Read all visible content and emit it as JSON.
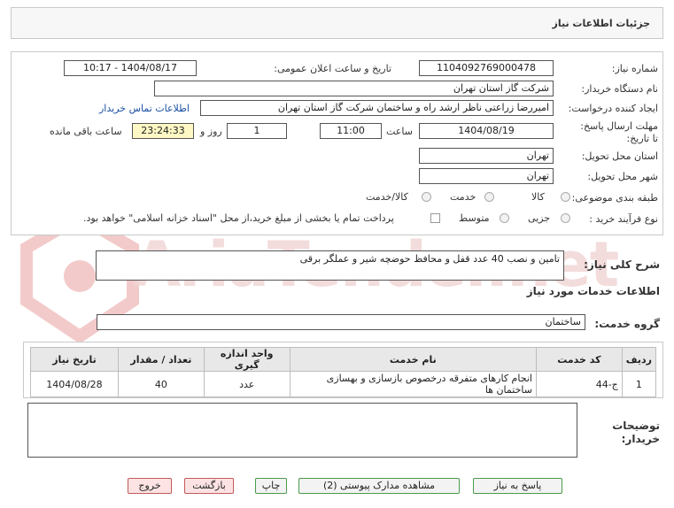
{
  "header": {
    "title": "جزئیات اطلاعات نیاز"
  },
  "form": {
    "need_number_label": "شماره نیاز:",
    "need_number": "1104092769000478",
    "announce_label": "تاریخ و ساعت اعلان عمومی:",
    "announce_value": "1404/08/17 - 10:17",
    "buyer_org_label": "نام دستگاه خریدار:",
    "buyer_org": "شرکت گاز استان تهران",
    "creator_label": "ایجاد کننده درخواست:",
    "creator": "امیررضا زراعتی ناظر ارشد راه و ساختمان شرکت گاز استان تهران",
    "contact_link": "اطلاعات تماس خریدار",
    "deadline_label": "مهلت ارسال پاسخ: تا تاریخ:",
    "deadline_date": "1404/08/19",
    "time_label": "ساعت",
    "deadline_time": "11:00",
    "days": "1",
    "days_label": "روز و",
    "remaining": "23:24:33",
    "remaining_label": "ساعت باقی مانده",
    "province_label": "استان محل تحویل:",
    "province": "تهران",
    "city_label": "شهر محل تحویل:",
    "city": "تهران",
    "category_label": "طبقه بندی موضوعی:",
    "category_options": [
      "کالا",
      "خدمت",
      "کالا/خدمت"
    ],
    "process_label": "نوع فرآیند خرید :",
    "process_options": [
      "جزیی",
      "متوسط"
    ],
    "payment_note": "پرداخت تمام یا بخشی از مبلغ خرید،از محل \"اسناد خزانه اسلامی\" خواهد بود."
  },
  "description": {
    "label": "شرح کلی نیاز:",
    "value": "تامین و نصب 40 عدد قفل و محافظ حوضچه شیر و عملگر برقی"
  },
  "services": {
    "section_title": "اطلاعات خدمات مورد نیاز",
    "group_label": "گروه خدمت:",
    "group_value": "ساختمان",
    "columns": [
      "ردیف",
      "کد خدمت",
      "نام خدمت",
      "واحد اندازه گیری",
      "تعداد / مقدار",
      "تاریخ نیاز"
    ],
    "rows": [
      {
        "row": "1",
        "code": "ج-44",
        "name": "انجام کارهای متفرقه درخصوص بازسازی و بهسازی ساختمان ها",
        "unit": "عدد",
        "qty": "40",
        "date": "1404/08/28"
      }
    ]
  },
  "notes": {
    "label": "توضیحات خریدار:"
  },
  "buttons": {
    "reply": "پاسخ به نیاز",
    "docs": "مشاهده مدارک پیوستی (2)",
    "print": "چاپ",
    "back": "بازگشت",
    "exit": "خروج"
  },
  "watermark": {
    "text": "AriaTender.net"
  }
}
